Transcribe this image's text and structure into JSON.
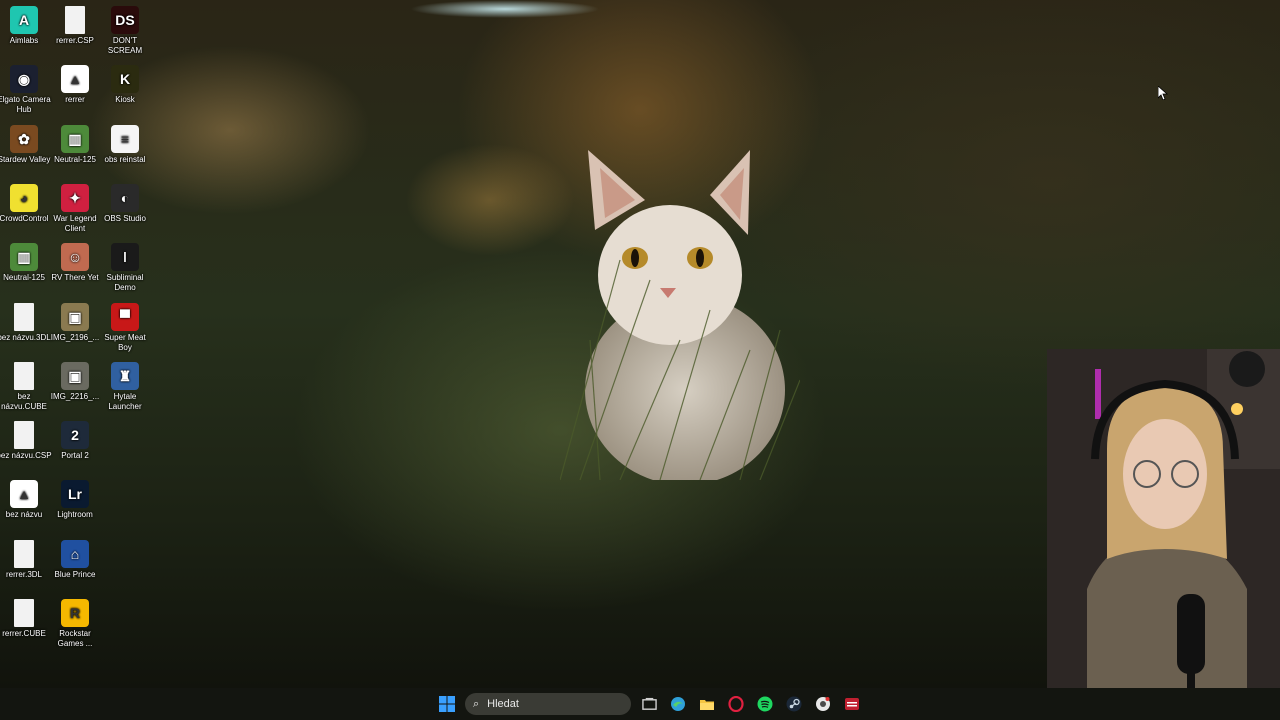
{
  "desktop": {
    "icons": [
      {
        "label": "Aimlabs",
        "icon": "aimlabs-icon",
        "color": "#1fc6b0",
        "glyph": "A"
      },
      {
        "label": "rerrer.CSP",
        "icon": "file-icon",
        "color": "#f2f2f2",
        "glyph": ""
      },
      {
        "label": "DON'T SCREAM",
        "icon": "dont-scream-icon",
        "color": "#2a0b0b",
        "glyph": "DS"
      },
      {
        "label": "Elgato Camera Hub",
        "icon": "elgato-icon",
        "color": "#1b2030",
        "glyph": "◉"
      },
      {
        "label": "rerrer",
        "icon": "affinity-icon",
        "color": "#ffffff",
        "glyph": "▲"
      },
      {
        "label": "Kiosk",
        "icon": "kiosk-icon",
        "color": "#2b2b10",
        "glyph": "K"
      },
      {
        "label": "Stardew Valley",
        "icon": "stardew-icon",
        "color": "#7a4a20",
        "glyph": "✿"
      },
      {
        "label": "Neutral-125",
        "icon": "neutral-icon",
        "color": "#4d8a3a",
        "glyph": "▥"
      },
      {
        "label": "obs reinstal",
        "icon": "json-file-icon",
        "color": "#f5f5f5",
        "glyph": "≡"
      },
      {
        "label": "CrowdControl",
        "icon": "crowdcontrol-icon",
        "color": "#f0e030",
        "glyph": "◕"
      },
      {
        "label": "War Legend Client",
        "icon": "war-legend-icon",
        "color": "#d02040",
        "glyph": "✦"
      },
      {
        "label": "OBS Studio",
        "icon": "obs-icon",
        "color": "#2a2a2a",
        "glyph": "◐"
      },
      {
        "label": "Neutral-125",
        "icon": "neutral-icon",
        "color": "#4d8a3a",
        "glyph": "▥"
      },
      {
        "label": "RV There Yet",
        "icon": "rv-there-yet-icon",
        "color": "#c06a50",
        "glyph": "☺"
      },
      {
        "label": "Subliminal Demo",
        "icon": "subliminal-icon",
        "color": "#1a1a1a",
        "glyph": "ǀ"
      },
      {
        "label": "bez názvu.3DL",
        "icon": "file-icon",
        "color": "#f2f2f2",
        "glyph": ""
      },
      {
        "label": "IMG_2196_...",
        "icon": "image-file-icon",
        "color": "#8a7a50",
        "glyph": "▣"
      },
      {
        "label": "Super Meat Boy",
        "icon": "super-meat-boy-icon",
        "color": "#c81818",
        "glyph": "▀"
      },
      {
        "label": "bez názvu.CUBE",
        "icon": "file-icon",
        "color": "#f2f2f2",
        "glyph": ""
      },
      {
        "label": "IMG_2216_...",
        "icon": "image-file-icon",
        "color": "#6a6a60",
        "glyph": "▣"
      },
      {
        "label": "Hytale Launcher",
        "icon": "hytale-icon",
        "color": "#3060a0",
        "glyph": "♜"
      },
      {
        "label": "bez názvu.CSP",
        "icon": "file-icon",
        "color": "#f2f2f2",
        "glyph": ""
      },
      {
        "label": "Portal 2",
        "icon": "portal-icon",
        "color": "#1e2a3a",
        "glyph": "2"
      },
      {
        "label": "bez názvu",
        "icon": "affinity-icon",
        "color": "#ffffff",
        "glyph": "▲"
      },
      {
        "label": "Lightroom",
        "icon": "lightroom-icon",
        "color": "#0a1a30",
        "glyph": "Lr"
      },
      {
        "label": "rerrer.3DL",
        "icon": "file-icon",
        "color": "#f2f2f2",
        "glyph": ""
      },
      {
        "label": "Blue Prince",
        "icon": "blue-prince-icon",
        "color": "#2050a0",
        "glyph": "⌂"
      },
      {
        "label": "rerrer.CUBE",
        "icon": "file-icon",
        "color": "#f2f2f2",
        "glyph": ""
      },
      {
        "label": "Rockstar Games ...",
        "icon": "rockstar-icon",
        "color": "#f5b800",
        "glyph": "R"
      }
    ]
  },
  "taskbar": {
    "search_placeholder": "Hledat",
    "items": [
      {
        "name": "start-button",
        "icon": "windows-icon",
        "color": "#3aa0ff"
      },
      {
        "name": "task-view-button",
        "icon": "task-view-icon",
        "color": "#d0d0d0"
      },
      {
        "name": "edge-button",
        "icon": "edge-icon",
        "color": "#2fa0d8"
      },
      {
        "name": "file-explorer-button",
        "icon": "folder-icon",
        "color": "#f5c542"
      },
      {
        "name": "opera-gx-button",
        "icon": "opera-gx-icon",
        "color": "#e02040"
      },
      {
        "name": "spotify-button",
        "icon": "spotify-icon",
        "color": "#1ed760"
      },
      {
        "name": "steam-button",
        "icon": "steam-icon",
        "color": "#c7d5e0"
      },
      {
        "name": "chrome-button",
        "icon": "chrome-icon",
        "color": "#e8e8e8"
      },
      {
        "name": "voicemeeter-button",
        "icon": "voicemeeter-icon",
        "color": "#c02030"
      }
    ]
  }
}
